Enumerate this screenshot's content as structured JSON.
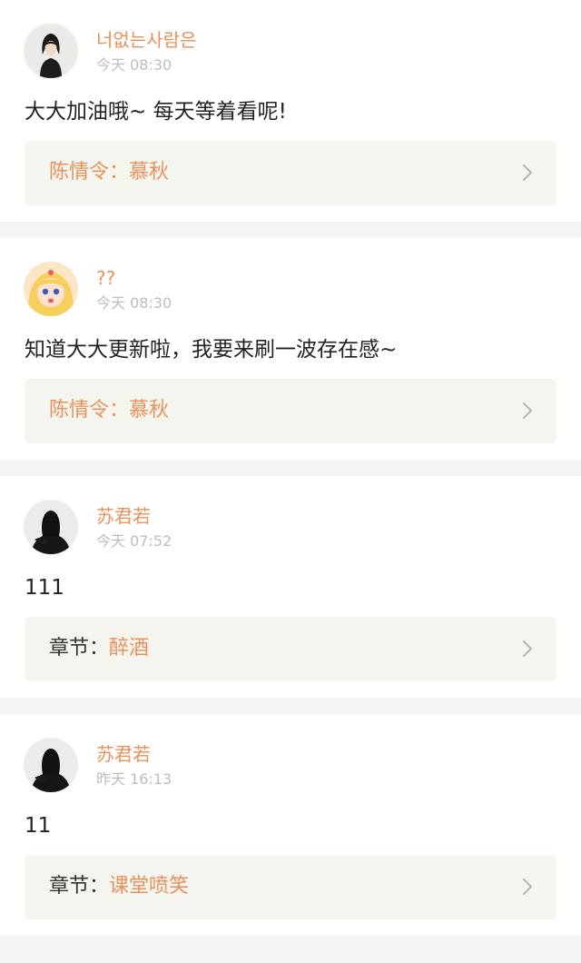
{
  "colors": {
    "accent": "#e8915a",
    "timestamp": "#bdbdbd",
    "content": "#222222",
    "ref_background": "#f5f5ef",
    "chevron": "#b8b8b8",
    "separator": "#f4f4f4"
  },
  "comments": [
    {
      "username": "너없는사람은",
      "time": "今天 08:30",
      "text": "大大加油哦~ 每天等着看呢!",
      "ref_prefix": "陈情令：",
      "ref_title": "慕秋",
      "avatar_icon": "girl-portrait-avatar"
    },
    {
      "username": "??",
      "time": "今天 08:30",
      "text": "知道大大更新啦，我要来刷一波存在感~",
      "ref_prefix": "陈情令：",
      "ref_title": "慕秋",
      "avatar_icon": "anime-girl-avatar"
    },
    {
      "username": "苏君若",
      "time": "今天 07:52",
      "text": "111",
      "ref_prefix": "章节：",
      "ref_title": "醉酒",
      "avatar_icon": "silhouette-avatar"
    },
    {
      "username": "苏君若",
      "time": "昨天 16:13",
      "text": "11",
      "ref_prefix": "章节：",
      "ref_title": "课堂喷笑",
      "avatar_icon": "silhouette-avatar"
    }
  ]
}
